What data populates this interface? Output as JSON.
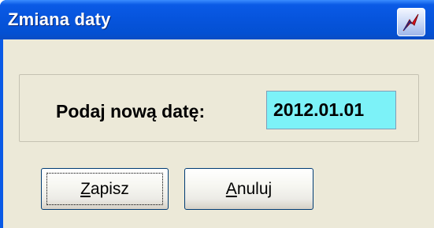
{
  "window": {
    "title": "Zmiana daty",
    "app_icon": "red-lightning-app-icon"
  },
  "form": {
    "prompt_label": "Podaj nową datę:",
    "date_value": "2012.01.01",
    "field_color": "#7cf2f8"
  },
  "buttons": {
    "save": {
      "mnemonic": "Z",
      "rest": "apisz",
      "is_default": true
    },
    "cancel": {
      "mnemonic": "A",
      "rest": "nuluj"
    }
  },
  "colors": {
    "titlebar": "#0a5ae6",
    "dialog_face": "#ece9d8"
  }
}
